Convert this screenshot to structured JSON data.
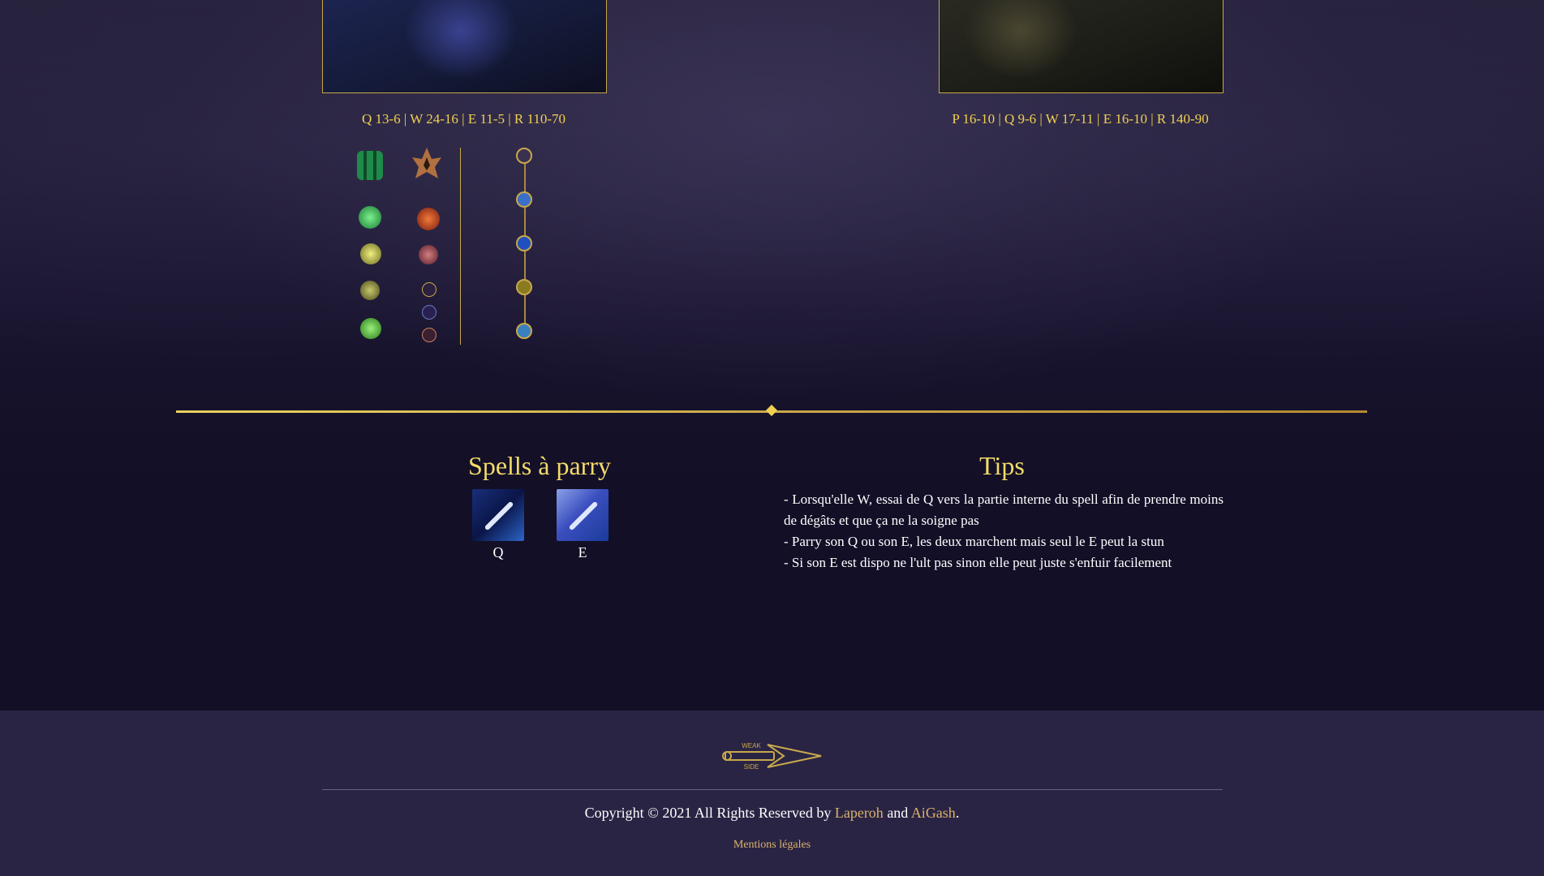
{
  "champions": {
    "left": {
      "cooldowns": "Q 13-6 | W 24-16 | E 11-5 | R 110-70"
    },
    "right": {
      "cooldowns": "P 16-10 | Q 9-6 | W 17-11 | E 16-10 | R 140-90"
    }
  },
  "runes": {
    "primary_tree": "resolve-tree-icon",
    "secondary_tree": "domination-tree-icon",
    "skill_order_icons": [
      "skill-1-icon",
      "skill-2-icon",
      "skill-3-icon",
      "skill-4-icon",
      "skill-5-icon"
    ]
  },
  "spells_section": {
    "title": "Spells à parry",
    "spells": [
      {
        "key": "Q"
      },
      {
        "key": "E"
      }
    ]
  },
  "tips_section": {
    "title": "Tips",
    "items": [
      "- Lorsqu'elle W, essai de Q vers la partie interne du spell afin de prendre moins de dégâts et que ça ne la soigne pas",
      "- Parry son Q ou son E, les deux marchent mais seul le E peut la stun",
      "- Si son E est dispo ne l'ult pas sinon elle peut juste s'enfuir facilement"
    ]
  },
  "footer": {
    "copyright_prefix": "Copyright © 2021 All Rights Reserved by ",
    "author1": "Laperoh",
    "and": " and ",
    "author2": "AiGash",
    "suffix": ".",
    "legal": "Mentions légales",
    "logo_text_top": "WEAK",
    "logo_text_bottom": "SIDE"
  },
  "colors": {
    "gold": "#f0d050",
    "accent": "#c8a84b",
    "link": "#d9b36a",
    "background": "#130f26",
    "footer": "#2a2444"
  }
}
